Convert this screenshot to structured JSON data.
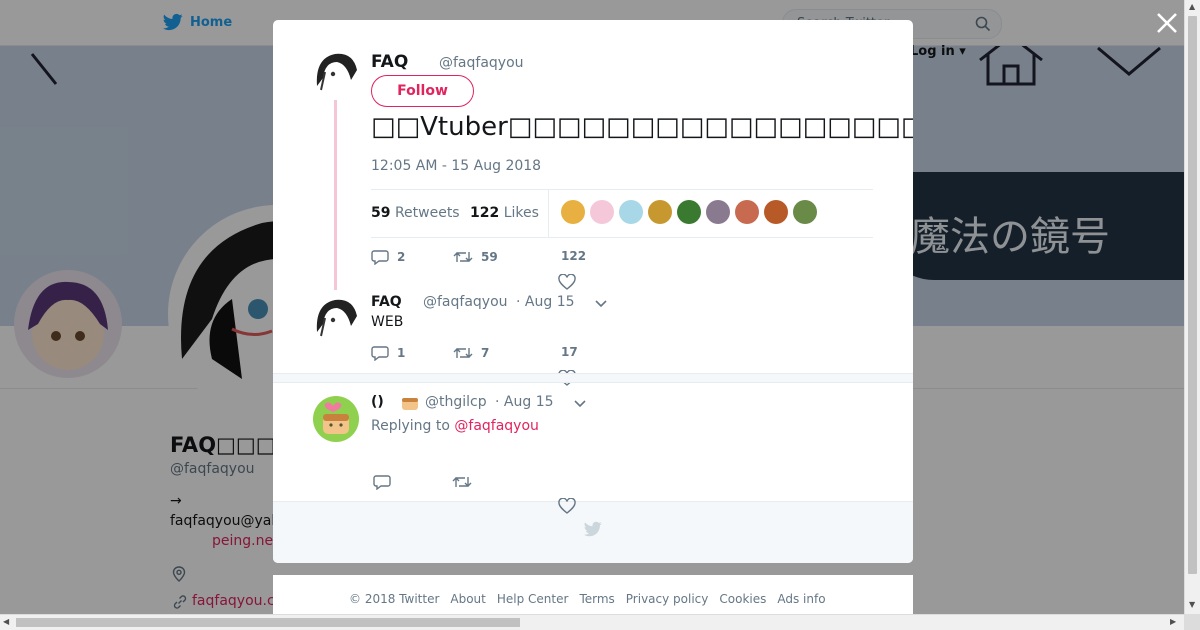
{
  "topbar": {
    "home_label": "Home",
    "search_placeholder": "Search Twitter",
    "login_label": "Log in"
  },
  "banner": {
    "text": "魔法の鏡号"
  },
  "profile": {
    "name": "FAQ□□□",
    "handle": "@faqfaqyou",
    "bio_line1": "→",
    "bio_line2": "faqfaqyou@yal",
    "bio_line3": "peing.ne",
    "url": "faqfaqyou.c"
  },
  "tweet": {
    "name": "FAQ",
    "handle": "@faqfaqyou",
    "follow_label": "Follow",
    "text": "□□Vtuber□□□□□□□□□□□□□□□□□□□□□□□□□□□□□□□□□□□□□□VR□",
    "timestamp": "12:05 AM - 15 Aug 2018",
    "retweets_count": "59",
    "retweets_label": "Retweets",
    "likes_count": "122",
    "likes_label": "Likes",
    "likers_colors": [
      "#e8b040",
      "#f4c8d8",
      "#a8d8e8",
      "#c89830",
      "#3a7a30",
      "#8a7a90",
      "#c86a50",
      "#b85a28",
      "#6a8a48"
    ],
    "actions": {
      "replies": "2",
      "retweets": "59",
      "likes": "122"
    }
  },
  "reply1": {
    "name": "FAQ",
    "handle": "@faqfaqyou",
    "date": "· Aug 15",
    "text": "WEB",
    "actions": {
      "replies": "1",
      "retweets": "7",
      "likes": "17"
    }
  },
  "reply2": {
    "name": "()",
    "handle": "@thgilcp",
    "date": "· Aug 15",
    "replying_prefix": "Replying to",
    "replying_to": "@faqfaqyou",
    "avatar_bg": "#8fd14f"
  },
  "footer": {
    "links": [
      "© 2018 Twitter",
      "About",
      "Help Center",
      "Terms",
      "Privacy policy",
      "Cookies",
      "Ads info"
    ]
  },
  "colors": {
    "accent": "#e0245e",
    "twitter_blue": "#1da1f2",
    "thread_line": "#f5c6d5"
  }
}
